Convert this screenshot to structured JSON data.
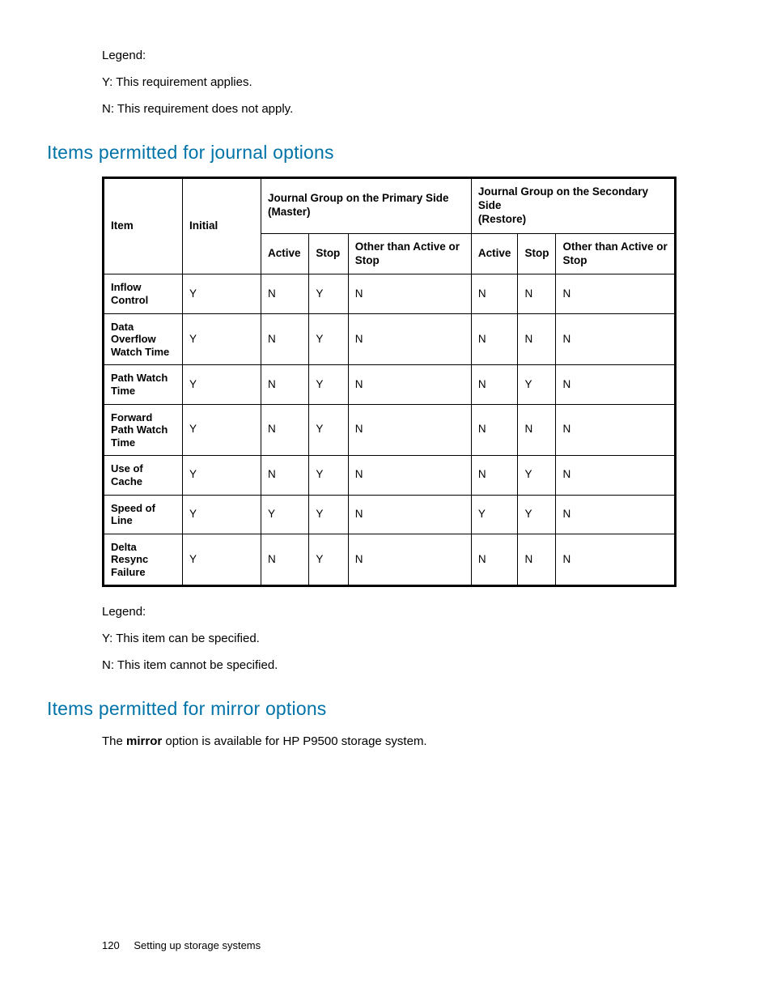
{
  "legend_top": {
    "title": "Legend:",
    "y": "Y: This requirement applies.",
    "n": "N: This requirement does not apply."
  },
  "section_journal": {
    "heading": "Items permitted for journal options",
    "headers": {
      "item": "Item",
      "initial": "Initial",
      "primary_group": "Journal Group on the Primary Side (Master)",
      "secondary_group": "Journal Group on the Secondary Side\n(Restore)",
      "active": "Active",
      "stop": "Stop",
      "other": "Other than Active or Stop"
    },
    "rows": [
      {
        "label": "Inflow Control",
        "initial": "Y",
        "p_active": "N",
        "p_stop": "Y",
        "p_other": "N",
        "s_active": "N",
        "s_stop": "N",
        "s_other": "N"
      },
      {
        "label": "Data Overflow Watch Time",
        "initial": "Y",
        "p_active": "N",
        "p_stop": "Y",
        "p_other": "N",
        "s_active": "N",
        "s_stop": "N",
        "s_other": "N"
      },
      {
        "label": "Path Watch Time",
        "initial": "Y",
        "p_active": "N",
        "p_stop": "Y",
        "p_other": "N",
        "s_active": "N",
        "s_stop": "Y",
        "s_other": "N"
      },
      {
        "label": "Forward Path Watch Time",
        "initial": "Y",
        "p_active": "N",
        "p_stop": "Y",
        "p_other": "N",
        "s_active": "N",
        "s_stop": "N",
        "s_other": "N"
      },
      {
        "label": "Use of Cache",
        "initial": "Y",
        "p_active": "N",
        "p_stop": "Y",
        "p_other": "N",
        "s_active": "N",
        "s_stop": "Y",
        "s_other": "N"
      },
      {
        "label": "Speed of Line",
        "initial": "Y",
        "p_active": "Y",
        "p_stop": "Y",
        "p_other": "N",
        "s_active": "Y",
        "s_stop": "Y",
        "s_other": "N"
      },
      {
        "label": "Delta Resync Failure",
        "initial": "Y",
        "p_active": "N",
        "p_stop": "Y",
        "p_other": "N",
        "s_active": "N",
        "s_stop": "N",
        "s_other": "N"
      }
    ],
    "legend_bottom": {
      "title": "Legend:",
      "y": "Y: This item can be specified.",
      "n": "N: This item cannot be specified."
    }
  },
  "section_mirror": {
    "heading": "Items permitted for mirror options",
    "text_pre": "The ",
    "text_bold": "mirror",
    "text_post": " option is available for HP P9500 storage system."
  },
  "footer": {
    "page": "120",
    "title": "Setting up storage systems"
  }
}
